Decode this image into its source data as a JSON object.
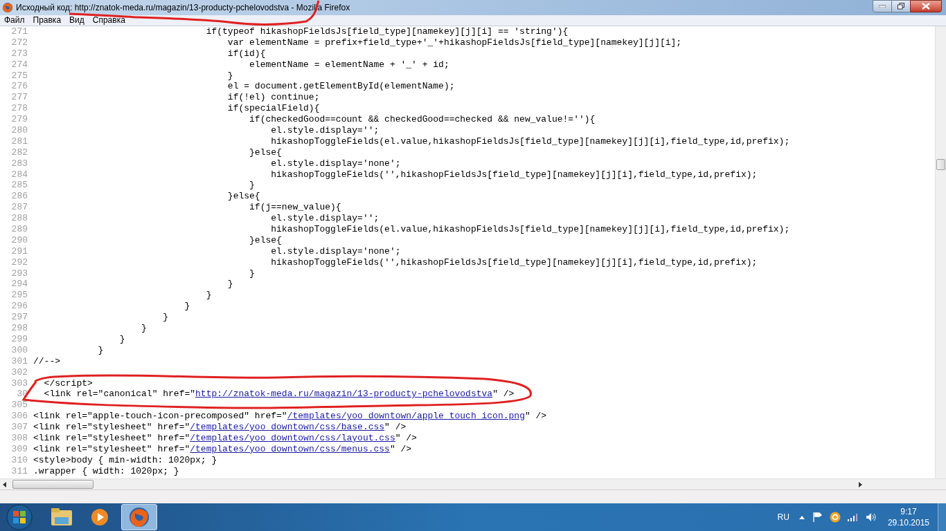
{
  "window": {
    "title": "Исходный код: http://znatok-meda.ru/magazin/13-producty-pchelovodstva - Mozilla Firefox"
  },
  "menu": [
    "Файл",
    "Правка",
    "Вид",
    "Справка"
  ],
  "source_lines": [
    {
      "number": "271",
      "segments": [
        {
          "kind": "plain",
          "text": "                                if(typeof hikashopFieldsJs[field_type][namekey][j][i] == 'string'){"
        }
      ]
    },
    {
      "number": "272",
      "segments": [
        {
          "kind": "plain",
          "text": "                                    var elementName = prefix+field_type+'_'+hikashopFieldsJs[field_type][namekey][j][i];"
        }
      ]
    },
    {
      "number": "273",
      "segments": [
        {
          "kind": "plain",
          "text": "                                    if(id){"
        }
      ]
    },
    {
      "number": "274",
      "segments": [
        {
          "kind": "plain",
          "text": "                                        elementName = elementName + '_' + id;"
        }
      ]
    },
    {
      "number": "275",
      "segments": [
        {
          "kind": "plain",
          "text": "                                    }"
        }
      ]
    },
    {
      "number": "276",
      "segments": [
        {
          "kind": "plain",
          "text": "                                    el = document.getElementById(elementName);"
        }
      ]
    },
    {
      "number": "277",
      "segments": [
        {
          "kind": "plain",
          "text": "                                    if(!el) continue;"
        }
      ]
    },
    {
      "number": "278",
      "segments": [
        {
          "kind": "plain",
          "text": "                                    if(specialField){"
        }
      ]
    },
    {
      "number": "279",
      "segments": [
        {
          "kind": "plain",
          "text": "                                        if(checkedGood==count && checkedGood==checked && new_value!=''){"
        }
      ]
    },
    {
      "number": "280",
      "segments": [
        {
          "kind": "plain",
          "text": "                                            el.style.display='';"
        }
      ]
    },
    {
      "number": "281",
      "segments": [
        {
          "kind": "plain",
          "text": "                                            hikashopToggleFields(el.value,hikashopFieldsJs[field_type][namekey][j][i],field_type,id,prefix);"
        }
      ]
    },
    {
      "number": "282",
      "segments": [
        {
          "kind": "plain",
          "text": "                                        }else{"
        }
      ]
    },
    {
      "number": "283",
      "segments": [
        {
          "kind": "plain",
          "text": "                                            el.style.display='none';"
        }
      ]
    },
    {
      "number": "284",
      "segments": [
        {
          "kind": "plain",
          "text": "                                            hikashopToggleFields('',hikashopFieldsJs[field_type][namekey][j][i],field_type,id,prefix);"
        }
      ]
    },
    {
      "number": "285",
      "segments": [
        {
          "kind": "plain",
          "text": "                                        }"
        }
      ]
    },
    {
      "number": "286",
      "segments": [
        {
          "kind": "plain",
          "text": "                                    }else{"
        }
      ]
    },
    {
      "number": "287",
      "segments": [
        {
          "kind": "plain",
          "text": "                                        if(j==new_value){"
        }
      ]
    },
    {
      "number": "288",
      "segments": [
        {
          "kind": "plain",
          "text": "                                            el.style.display='';"
        }
      ]
    },
    {
      "number": "289",
      "segments": [
        {
          "kind": "plain",
          "text": "                                            hikashopToggleFields(el.value,hikashopFieldsJs[field_type][namekey][j][i],field_type,id,prefix);"
        }
      ]
    },
    {
      "number": "290",
      "segments": [
        {
          "kind": "plain",
          "text": "                                        }else{"
        }
      ]
    },
    {
      "number": "291",
      "segments": [
        {
          "kind": "plain",
          "text": "                                            el.style.display='none';"
        }
      ]
    },
    {
      "number": "292",
      "segments": [
        {
          "kind": "plain",
          "text": "                                            hikashopToggleFields('',hikashopFieldsJs[field_type][namekey][j][i],field_type,id,prefix);"
        }
      ]
    },
    {
      "number": "293",
      "segments": [
        {
          "kind": "plain",
          "text": "                                        }"
        }
      ]
    },
    {
      "number": "294",
      "segments": [
        {
          "kind": "plain",
          "text": "                                    }"
        }
      ]
    },
    {
      "number": "295",
      "segments": [
        {
          "kind": "plain",
          "text": "                                }"
        }
      ]
    },
    {
      "number": "296",
      "segments": [
        {
          "kind": "plain",
          "text": "                            }"
        }
      ]
    },
    {
      "number": "297",
      "segments": [
        {
          "kind": "plain",
          "text": "                        }"
        }
      ]
    },
    {
      "number": "298",
      "segments": [
        {
          "kind": "plain",
          "text": "                    }"
        }
      ]
    },
    {
      "number": "299",
      "segments": [
        {
          "kind": "plain",
          "text": "                }"
        }
      ]
    },
    {
      "number": "300",
      "segments": [
        {
          "kind": "plain",
          "text": "            }"
        }
      ]
    },
    {
      "number": "301",
      "segments": [
        {
          "kind": "plain",
          "text": "//-->"
        }
      ]
    },
    {
      "number": "302"
    },
    {
      "number": "303",
      "segments": [
        {
          "kind": "plain",
          "text": "  </script>"
        }
      ]
    },
    {
      "number": "30",
      "segments": [
        {
          "kind": "plain",
          "text": "  <link rel=\"canonical\" href=\""
        },
        {
          "kind": "link",
          "text": "http://znatok-meda.ru/magazin/13-producty-pchelovodstva"
        },
        {
          "kind": "plain",
          "text": "\" />"
        }
      ]
    },
    {
      "number": "305"
    },
    {
      "number": "306",
      "segments": [
        {
          "kind": "plain",
          "text": "<link rel=\"apple-touch-icon-precomposed\" href=\""
        },
        {
          "kind": "link",
          "text": "/templates/yoo_downtown/apple_touch_icon.png"
        },
        {
          "kind": "plain",
          "text": "\" />"
        }
      ]
    },
    {
      "number": "307",
      "segments": [
        {
          "kind": "plain",
          "text": "<link rel=\"stylesheet\" href=\""
        },
        {
          "kind": "link",
          "text": "/templates/yoo_downtown/css/base.css"
        },
        {
          "kind": "plain",
          "text": "\" />"
        }
      ]
    },
    {
      "number": "308",
      "segments": [
        {
          "kind": "plain",
          "text": "<link rel=\"stylesheet\" href=\""
        },
        {
          "kind": "link",
          "text": "/templates/yoo_downtown/css/layout.css"
        },
        {
          "kind": "plain",
          "text": "\" />"
        }
      ]
    },
    {
      "number": "309",
      "segments": [
        {
          "kind": "plain",
          "text": "<link rel=\"stylesheet\" href=\""
        },
        {
          "kind": "link",
          "text": "/templates/yoo_downtown/css/menus.css"
        },
        {
          "kind": "plain",
          "text": "\" />"
        }
      ]
    },
    {
      "number": "310",
      "segments": [
        {
          "kind": "plain",
          "text": "<style>body { min-width: 1020px; }"
        }
      ]
    },
    {
      "number": "311",
      "segments": [
        {
          "kind": "plain",
          "text": ".wrapper { width: 1020px; }"
        }
      ]
    }
  ],
  "taskbar": {
    "apps": [
      {
        "kind": "explorer",
        "selected": false
      },
      {
        "kind": "media",
        "selected": false
      },
      {
        "kind": "firefox",
        "selected": true
      }
    ],
    "language": "RU",
    "time": "9:17",
    "date": "29.10.2015"
  }
}
